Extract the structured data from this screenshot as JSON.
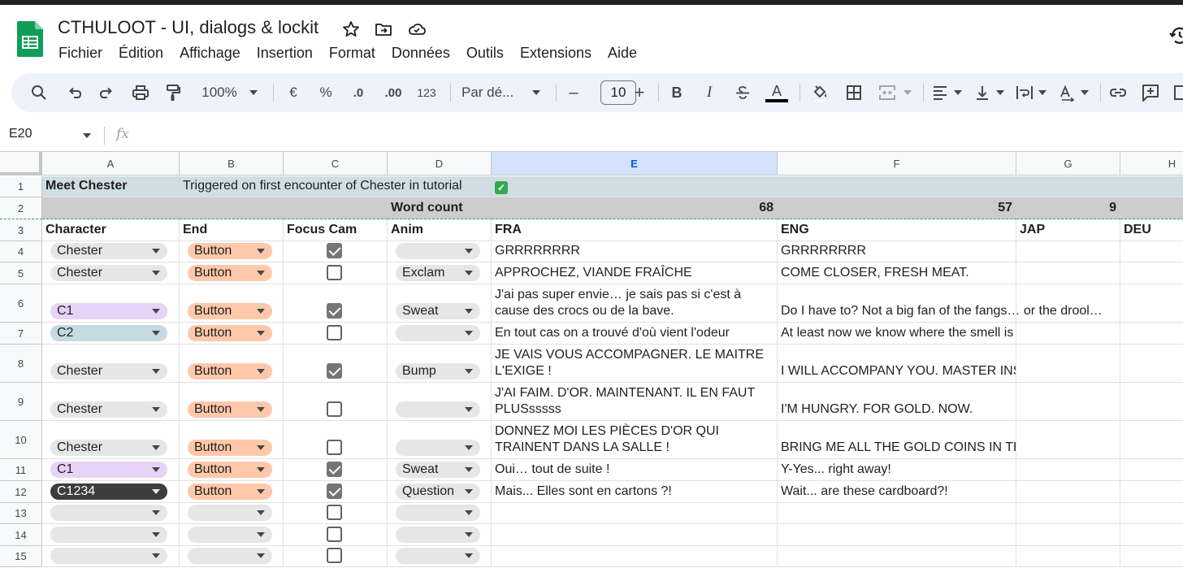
{
  "app": {
    "title": "CTHULOOT - UI, dialogs & lockit",
    "logo": "sheets-logo",
    "title_icons": [
      "star-icon",
      "move-to-folder-icon",
      "cloud-status-icon"
    ]
  },
  "menu": [
    "Fichier",
    "Édition",
    "Affichage",
    "Insertion",
    "Format",
    "Données",
    "Outils",
    "Extensions",
    "Aide"
  ],
  "toolbar": {
    "zoom": "100%",
    "currency": "€",
    "percent": "%",
    "decrease_decimal": ".0",
    "increase_decimal": ".00",
    "number_format": "123",
    "font": "Par dé...",
    "font_size": "10",
    "minus": "–",
    "plus": "+",
    "bold": "B",
    "italic": "I",
    "text_color": "A",
    "text_color_value": "#000000"
  },
  "formula_bar": {
    "name_box": "E20",
    "fx": "fx"
  },
  "columns": [
    "A",
    "B",
    "C",
    "D",
    "E",
    "F",
    "G",
    "H"
  ],
  "selected_column": "E",
  "rows": [
    {
      "num": "1",
      "A": "Meet Chester",
      "B": "Triggered on first encounter of Chester in tutorial",
      "E_icon": "✓"
    },
    {
      "num": "2",
      "D": "Word count",
      "E": "68",
      "F": "57",
      "G": "9"
    },
    {
      "num": "3",
      "A": "Character",
      "B": "End",
      "C": "Focus Cam",
      "D": "Anim",
      "E": "FRA",
      "F": "ENG",
      "G": "JAP",
      "H": "DEU"
    },
    {
      "num": "4",
      "character": "Chester",
      "end": "Button",
      "focus": true,
      "anim": "",
      "fra": "GRRRRRRRR",
      "eng": "GRRRRRRRR"
    },
    {
      "num": "5",
      "character": "Chester",
      "end": "Button",
      "focus": false,
      "anim": "Exclam",
      "fra": "APPROCHEZ, VIANDE FRAÎCHE",
      "eng": "COME CLOSER, FRESH MEAT."
    },
    {
      "num": "6",
      "character": "C1",
      "end": "Button",
      "focus": true,
      "anim": "Sweat",
      "fra": "J'ai pas super envie… je sais pas si c'est à cause des crocs ou de la bave.",
      "eng": "Do I have to? Not a big fan of the fangs… or the drool…"
    },
    {
      "num": "7",
      "character": "C2",
      "end": "Button",
      "focus": false,
      "anim": "",
      "fra": "En tout cas on a trouvé d'où vient l'odeur",
      "eng": "At least now we know where the smell is coming from."
    },
    {
      "num": "8",
      "character": "Chester",
      "end": "Button",
      "focus": true,
      "anim": "Bump",
      "fra": "JE VAIS VOUS ACCOMPAGNER. LE MAITRE L'EXIGE !",
      "eng": "I WILL ACCOMPANY YOU. MASTER INSISTS."
    },
    {
      "num": "9",
      "character": "Chester",
      "end": "Button",
      "focus": false,
      "anim": "",
      "fra": "J'AI FAIM. D'OR. MAINTENANT. IL EN FAUT PLUSsssss",
      "eng": "I'M HUNGRY. FOR GOLD. NOW."
    },
    {
      "num": "10",
      "character": "Chester",
      "end": "Button",
      "focus": false,
      "anim": "",
      "fra": "DONNEZ MOI LES PIÈCES D'OR QUI TRAINENT DANS LA SALLE !",
      "eng": "BRING ME ALL THE GOLD COINS IN THIS ROOM!"
    },
    {
      "num": "11",
      "character": "C1",
      "end": "Button",
      "focus": true,
      "anim": "Sweat",
      "fra": "Oui… tout de suite !",
      "eng": "Y-Yes... right away!"
    },
    {
      "num": "12",
      "character": "C1234",
      "end": "Button",
      "focus": true,
      "anim": "Question",
      "fra": "Mais... Elles sont en cartons ?!",
      "eng": "Wait... are these cardboard?!"
    },
    {
      "num": "13",
      "character": "",
      "end": "",
      "focus": false,
      "anim": "",
      "fra": "",
      "eng": ""
    },
    {
      "num": "14",
      "character": "",
      "end": "",
      "focus": false,
      "anim": "",
      "fra": "",
      "eng": ""
    },
    {
      "num": "15",
      "character": "",
      "end": "",
      "focus": false,
      "anim": "",
      "fra": "",
      "eng": ""
    }
  ],
  "chip_colors": {
    "Chester": "#e6e6e6",
    "C1": "#e7d3f5",
    "C2": "#c6dbe1",
    "C1234": "#3d3d3d",
    "empty": "#e6e6e6",
    "Button": "#ffc8aa",
    "anim": "#e6e6e6"
  },
  "accent": {
    "header_row1": "#d0dee3",
    "header_row2": "#cccccc",
    "selected_col": "#d3e3fd"
  }
}
